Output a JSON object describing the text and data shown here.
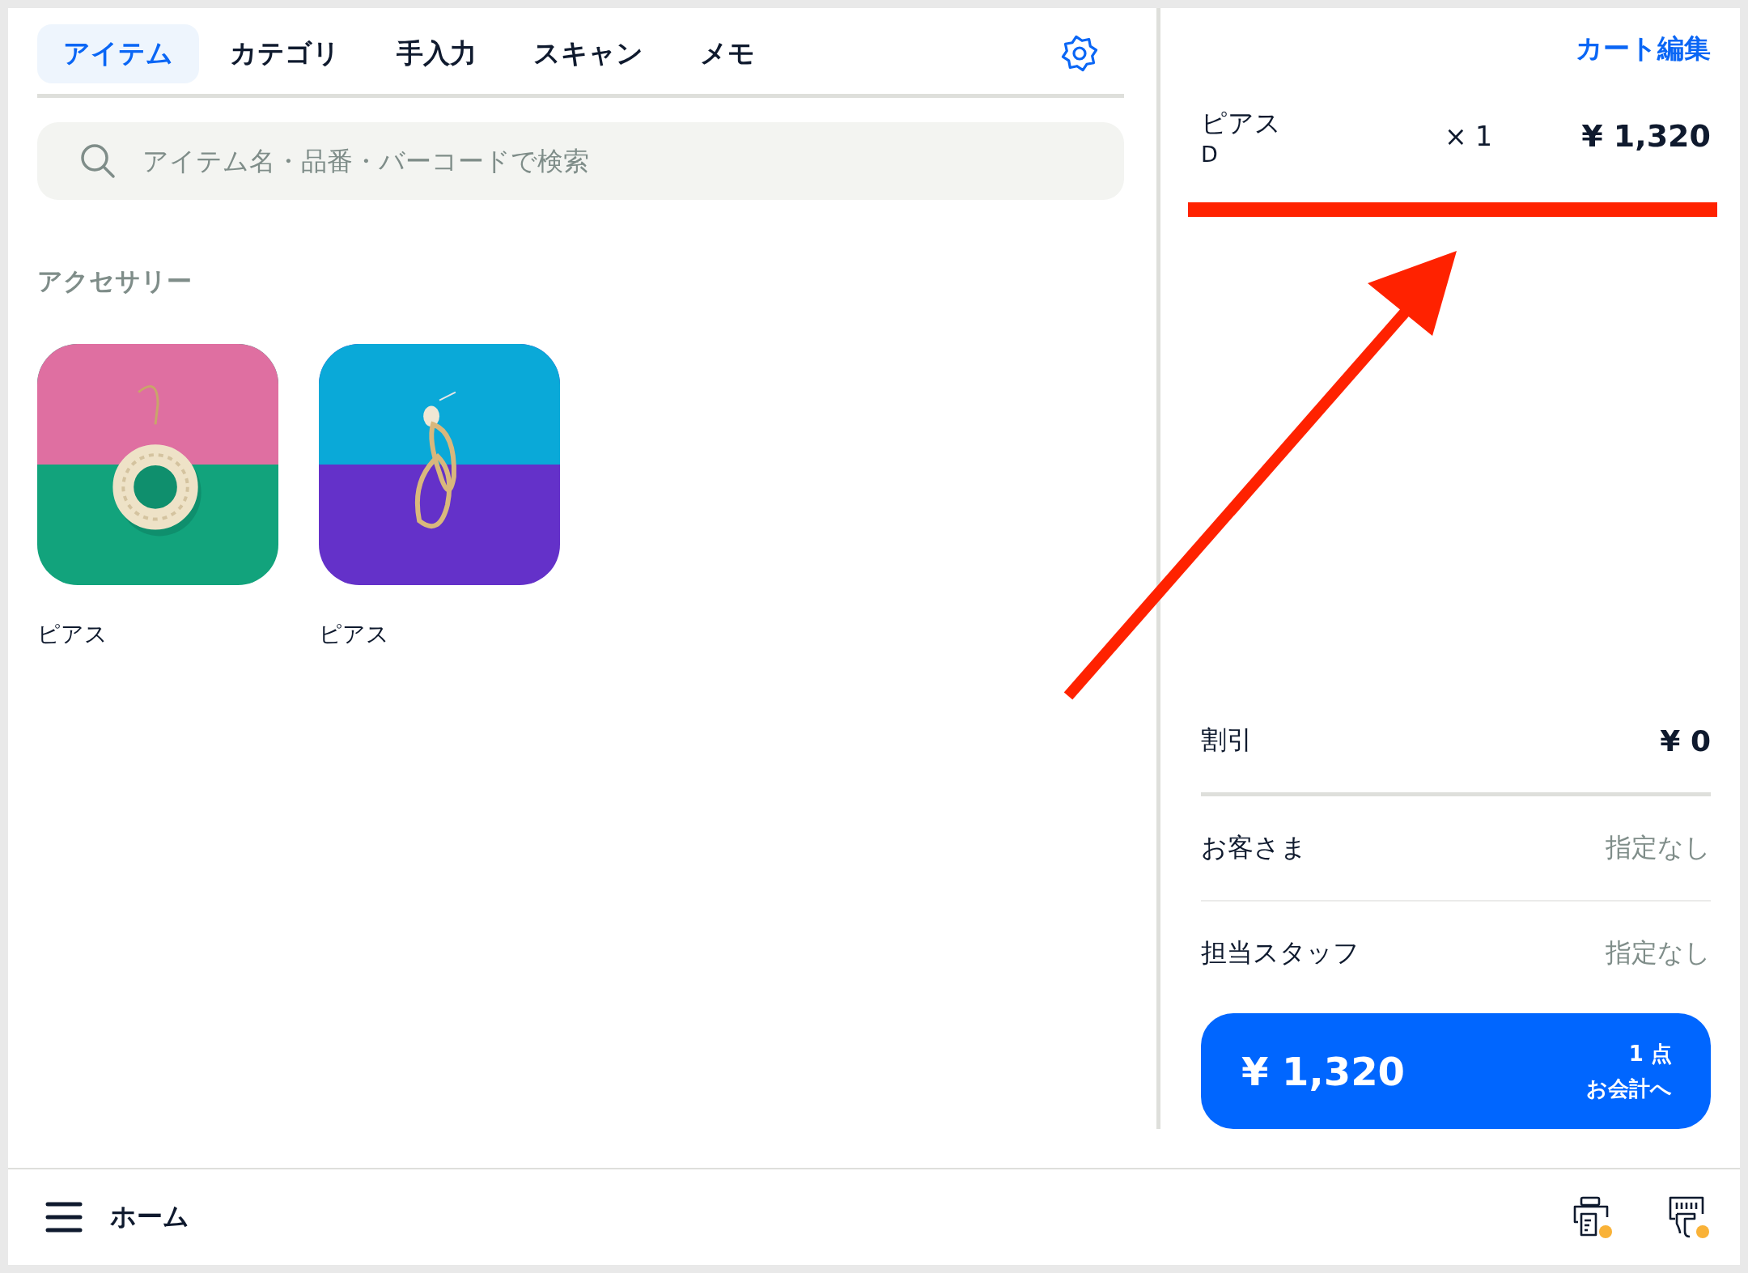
{
  "tabs": [
    {
      "label": "アイテム",
      "selected": true
    },
    {
      "label": "カテゴリ",
      "selected": false
    },
    {
      "label": "手入力",
      "selected": false
    },
    {
      "label": "スキャン",
      "selected": false
    },
    {
      "label": "メモ",
      "selected": false
    }
  ],
  "search": {
    "placeholder": "アイテム名・品番・バーコードで検索"
  },
  "section": {
    "title": "アクセサリー",
    "items": [
      {
        "name": "ピアス",
        "kind": "picture"
      },
      {
        "name": "ピアス",
        "kind": "picture"
      }
    ]
  },
  "cart": {
    "edit_link": "カート編集",
    "items": [
      {
        "name": "ピアス",
        "variant": "D",
        "quantity": "× 1",
        "price": "¥ 1,320"
      }
    ],
    "discount": {
      "label": "割引",
      "value": "¥ 0"
    },
    "customer": {
      "label": "お客さま",
      "value": "指定なし"
    },
    "staff": {
      "label": "担当スタッフ",
      "value": "指定なし"
    },
    "checkout": {
      "total": "¥ 1,320",
      "count": "1 点",
      "action": "お会計へ"
    }
  },
  "bottom_bar": {
    "title": "ホーム",
    "devices": [
      {
        "kind": "printer",
        "warning": true
      },
      {
        "kind": "reader",
        "warning": true
      }
    ]
  },
  "annotations": {
    "highlight_bar": true,
    "arrow": true
  }
}
